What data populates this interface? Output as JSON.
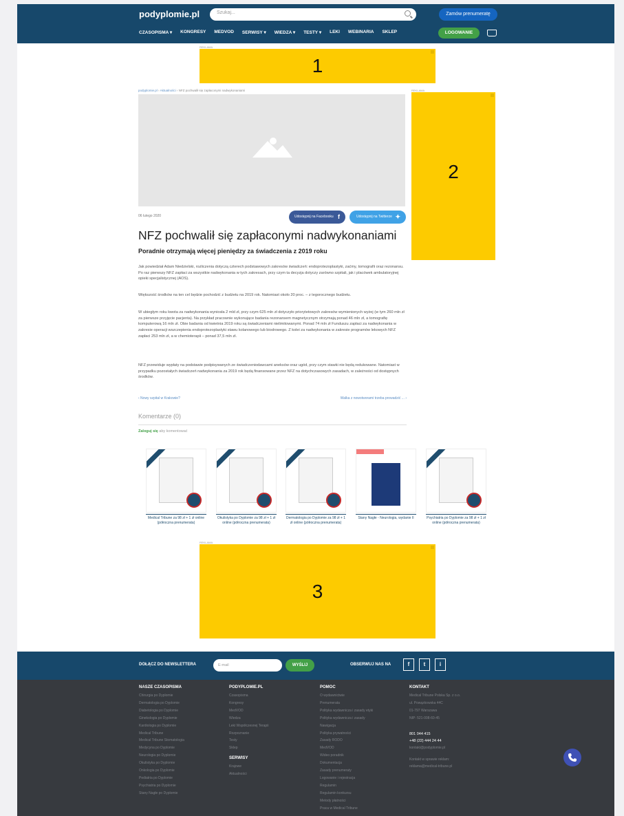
{
  "header": {
    "logo": "podyplomie.pl",
    "search_placeholder": "Szukaj...",
    "subscribe_label": "Zamów prenumeratę",
    "nav": [
      "CZASOPISMA ▾",
      "KONGRESY",
      "MEDVOD",
      "SERWISY ▾",
      "WIEDZA ▾",
      "TESTY ▾",
      "LEKI",
      "WEBINARIA",
      "SKLEP"
    ],
    "login_label": "LOGOWANIE"
  },
  "ads": {
    "label": "REKLAMA",
    "ad1": "1",
    "ad2": "2",
    "ad3": "3"
  },
  "breadcrumb": {
    "home": "podyplomie.pl",
    "section": "Aktualności",
    "current": "NFZ pochwalił się zapłaconymi nadwykonaniami"
  },
  "article": {
    "date": "06 lutego 2020",
    "share_facebook": "Udostępnij na Facebooku",
    "share_twitter": "Udostępnij na Twitterze",
    "title": "NFZ pochwalił się zapłaconymi nadwykonaniami",
    "subtitle": "Poradnie otrzymają więcej pieniędzy za świadczenia z 2019 roku",
    "paragraphs": [
      "Jak powiedział Adam Niedzielski, rozliczenia dotyczą czterech podstawowych zakresów świadczeń: endoprotezoplastyki, zaćmy, tomografii oraz rezonansu. Po raz pierwszy NFZ zapłaci za wszystkie nadwykonania w tych zakresach, przy czym ta decyzja dotyczy zarówno szpitali, jak i placówek ambulatoryjnej opieki specjalistycznej (AOS).",
      "Większość środków na ten cel będzie pochodzić z budżetu na 2019 rok. Natomiast około 20 proc. – z tegorocznego budżetu.",
      "W ubiegłym roku kwota za nadwykonania wyniosła 2 mld zł, przy czym 625 mln zł dotyczyło priorytetowych zakresów wymienionych wyżej (w tym 260 mln zł za pierwsze przyjęcie pacjenta). Na przykład pracownie wykonujące badania rezonansem magnetycznym otrzymają ponad 46 mln zł, a tomografię komputerową 16 mln zł. Obie badania od kwietnia 2019 roku są świadczeniami nielimitowanymi. Ponad 74 mln zł Funduszu zapłaci za nadwykonania w zakresie operacji wszczepienia endoprotezoplastyki stawu kolanowego lub biodrowego. Z kolei za nadwykonania w zakresie programów lekowych NFZ zapłaci 253 mln zł, a w chemioterapii – ponad 37,5 mln zł.",
      "NFZ przewiduje wypłaty na podstawie podpisywanych ze świadczeniodawcami aneksów oraz ugód, przy czym stawki nie będą redukowane. Natomiast w przypadku pozostałych świadczeń nadwykonania za 2019 rok będą finansowane przez NFZ na dotychczasowych zasadach, w zależności od dostępnych środków."
    ],
    "prev_link": "‹ Nowy szpital w Krakowie?",
    "next_link": "Walka z nowotworami trzeba prowadzić ... ›"
  },
  "comments": {
    "title": "Komentarze (0)",
    "login_link": "Zaloguj się",
    "login_suffix": " aby komentować"
  },
  "products": [
    {
      "caption": "Medical Tribune za 98 zł + 1 zł online (półroczna prenumerata)"
    },
    {
      "caption": "Okulistyka po Dyplomie za 98 zł + 1 zł online (półroczna prenumerata)"
    },
    {
      "caption": "Dermatologia po Dyplomie za 98 zł + 1 zł online (półroczna prenumerata)"
    },
    {
      "caption": "Stany Nagłe - Neurologia, wydanie II"
    },
    {
      "caption": "Psychiatria po Dyplomie za 98 zł + 1 zł online (półroczna prenumerata)"
    }
  ],
  "footer": {
    "newsletter_label": "DOŁĄCZ DO NEWSLETTERA",
    "email_placeholder": "E-mail",
    "send_label": "WYŚLIJ",
    "follow_label": "OBSERWUJ NAS NA",
    "social": [
      "f",
      "t",
      "i"
    ],
    "col1": {
      "title": "NASZE CZASOPISMA",
      "links": [
        "Chirurgia po Dyplomie",
        "Dermatologia po Dyplomie",
        "Diabetologia po Dyplomie",
        "Ginekologia po Dyplomie",
        "Kardiologia po Dyplomie",
        "Medical Tribune",
        "Medical Tribune Stomatologia",
        "Medycyna po Dyplomie",
        "Neurologia po Dyplomie",
        "Okulistyka po Dyplomie",
        "Onkologia po Dyplomie",
        "Pediatria po Dyplomie",
        "Psychiatria po Dyplomie",
        "Stany Nagłe po Dyplomie"
      ]
    },
    "col2": {
      "title": "PODYPLOMIE.PL",
      "links": [
        "Czasopisma",
        "Kongresy",
        "MedVOD",
        "Wiedza",
        "Leki Współczesnej Terapii",
        "Rozpoznanie",
        "Testy",
        "Sklep"
      ],
      "title2": "SERWISY",
      "links2": [
        "Krajowe",
        "Aktualności"
      ]
    },
    "col3": {
      "title": "POMOC",
      "links": [
        "O wydawnictwie",
        "Prenumerata",
        "Polityka wydawnicza i zasady etyki",
        "Polityka wydawnicza i zasady",
        "Nawigacja",
        "Polityka prywatności",
        "Zasady RODO",
        "MedVOD",
        "Wideo poradnik",
        "Dokumentacja",
        "Zasady prenumeraty",
        "Logowanie i rejestracja",
        "Regulamin",
        "Regulamin konkursu",
        "Metody płatności",
        "Praca w Medical Tribune"
      ]
    },
    "col4": {
      "title": "KONTAKT",
      "lines": [
        "Medical Tribune Polska Sp. z o.o.",
        "ul. Powązkowska 44C",
        "01-797 Warszawa",
        "NIP: 521-008-60-45"
      ],
      "phone1": "801 044 415",
      "phone2": "+48 (22) 444 24 44",
      "email": "kontakt@podyplomie.pl",
      "press_label": "Kontakt w sprawie reklam:",
      "press_email": "reklama@medical-tribune.pl"
    }
  },
  "colors": {
    "header_bg": "#17486b",
    "ad_yellow": "#fdcb00",
    "green": "#43a047",
    "footer_bg": "#373a3f"
  }
}
